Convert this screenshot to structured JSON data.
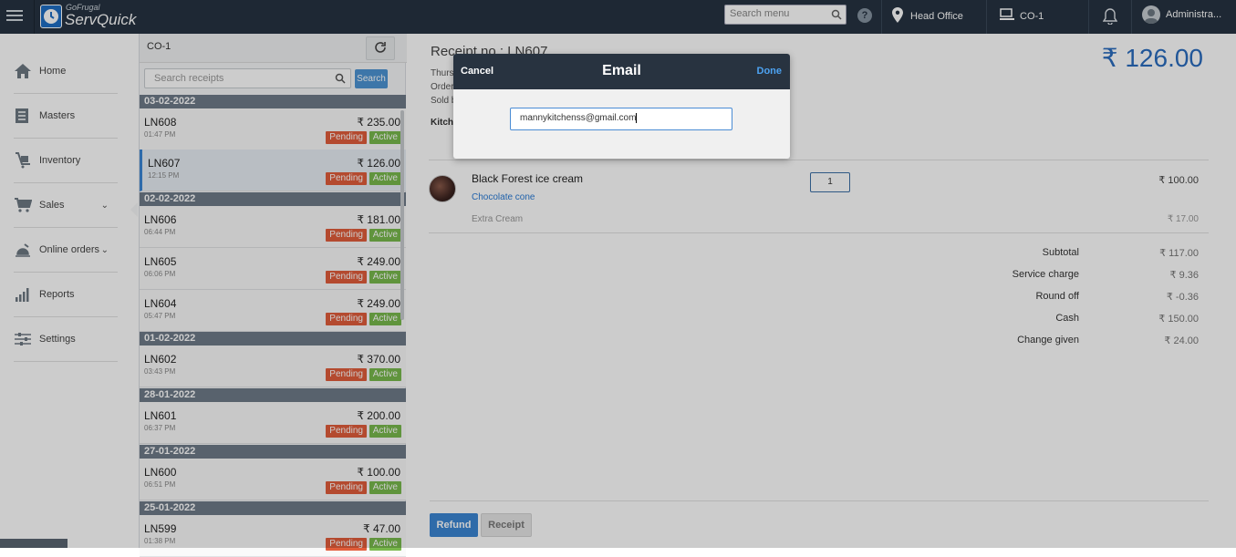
{
  "header": {
    "logo_small": "GoFrugal",
    "logo_big": "ServQuick",
    "search_placeholder": "Search menu",
    "location": "Head Office",
    "terminal": "CO-1",
    "user": "Administra..."
  },
  "sidebar": {
    "items": [
      {
        "label": "Home",
        "icon": "home-icon"
      },
      {
        "label": "Masters",
        "icon": "masters-icon"
      },
      {
        "label": "Inventory",
        "icon": "inventory-icon"
      },
      {
        "label": "Sales",
        "icon": "cart-icon"
      },
      {
        "label": "Online orders",
        "icon": "online-orders-icon"
      },
      {
        "label": "Reports",
        "icon": "reports-icon"
      },
      {
        "label": "Settings",
        "icon": "settings-icon"
      }
    ]
  },
  "receipts": {
    "counter": "CO-1",
    "search_placeholder": "Search receipts",
    "search_button": "Search",
    "pending_label": "Pending",
    "active_label": "Active",
    "groups": [
      {
        "date": "03-02-2022",
        "items": [
          {
            "no": "LN608",
            "time": "01:47 PM",
            "amount": "₹ 235.00"
          },
          {
            "no": "LN607",
            "time": "12:15 PM",
            "amount": "₹ 126.00"
          }
        ]
      },
      {
        "date": "02-02-2022",
        "items": [
          {
            "no": "LN606",
            "time": "06:44 PM",
            "amount": "₹ 181.00"
          },
          {
            "no": "LN605",
            "time": "06:06 PM",
            "amount": "₹ 249.00"
          },
          {
            "no": "LN604",
            "time": "05:47 PM",
            "amount": "₹ 249.00"
          }
        ]
      },
      {
        "date": "01-02-2022",
        "items": [
          {
            "no": "LN602",
            "time": "03:43 PM",
            "amount": "₹ 370.00"
          }
        ]
      },
      {
        "date": "28-01-2022",
        "items": [
          {
            "no": "LN601",
            "time": "06:37 PM",
            "amount": "₹ 200.00"
          }
        ]
      },
      {
        "date": "27-01-2022",
        "items": [
          {
            "no": "LN600",
            "time": "06:51 PM",
            "amount": "₹ 100.00"
          }
        ]
      },
      {
        "date": "25-01-2022",
        "items": [
          {
            "no": "LN599",
            "time": "01:38 PM",
            "amount": "₹ 47.00"
          }
        ]
      }
    ]
  },
  "detail": {
    "receipt_no": "Receipt no : LN607",
    "meta1": "Thurs",
    "meta2": "Order",
    "meta3": "Sold b",
    "kitchen": "Kitch",
    "total": "₹ 126.00",
    "item_name": "Black Forest ice cream",
    "item_variant": "Chocolate cone",
    "item_modifier": "Extra Cream",
    "item_qty": "1",
    "item_amount": "₹ 100.00",
    "modifier_amount": "₹ 17.00",
    "summary": [
      {
        "label": "Subtotal",
        "value": "₹ 117.00"
      },
      {
        "label": "Service charge",
        "value": "₹ 9.36"
      },
      {
        "label": "Round off",
        "value": "₹ -0.36"
      },
      {
        "label": "Cash",
        "value": "₹ 150.00"
      },
      {
        "label": "Change given",
        "value": "₹ 24.00"
      }
    ],
    "refund_button": "Refund",
    "receipt_button": "Receipt"
  },
  "email_dialog": {
    "cancel": "Cancel",
    "title": "Email",
    "done": "Done",
    "email_value": "mannykitchenss@gmail.com"
  },
  "colors": {
    "topbar": "#263341",
    "accent": "#2a6cbf",
    "pending": "#e25d3b",
    "active": "#79b94d"
  }
}
